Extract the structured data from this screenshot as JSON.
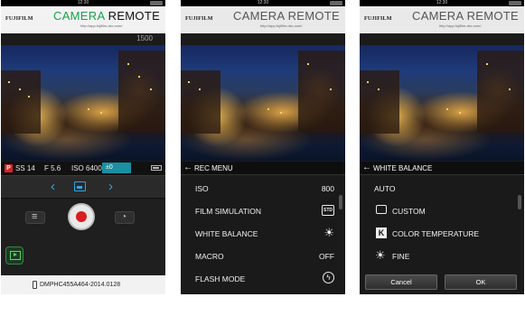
{
  "screens": [
    {
      "status_time": "12:30",
      "brand": "FUJIFILM",
      "title_part1": "CAMERA",
      "title_part2": "REMOTE",
      "url": "http://app.fujifilm-dsc.com/",
      "shots_remaining": "1500",
      "info": {
        "program_badge": "P",
        "shutter": "SS 14",
        "aperture": "F 5.6",
        "iso": "ISO 6400",
        "exposure": "±0"
      },
      "icons": [
        "left-chevron",
        "mode-icon",
        "right-chevron",
        "list-icon",
        "shutter-button",
        "self-timer-icon",
        "playback-icon",
        "phone-icon",
        "battery-icon"
      ],
      "device_name": "DMPHC455A464-2014.0128"
    },
    {
      "status_time": "12:30",
      "brand": "FUJIFILM",
      "title": "CAMERA REMOTE",
      "url": "http://app.fujifilm-dsc.com/",
      "menu_title": "REC MENU",
      "items": [
        {
          "label": "ISO",
          "value": "800"
        },
        {
          "label": "FILM SIMULATION",
          "value": "STD"
        },
        {
          "label": "WHITE BALANCE",
          "value": ""
        },
        {
          "label": "MACRO",
          "value": "OFF"
        },
        {
          "label": "FLASH MODE",
          "value": ""
        }
      ]
    },
    {
      "status_time": "12:30",
      "brand": "FUJIFILM",
      "title": "CAMERA REMOTE",
      "url": "http://app.fujifilm-dsc.com/",
      "menu_title": "WHITE BALANCE",
      "items": [
        {
          "label": "AUTO",
          "icon": "none"
        },
        {
          "label": "CUSTOM",
          "icon": "custom-icon"
        },
        {
          "label": "COLOR TEMPERATURE",
          "icon": "k-icon"
        },
        {
          "label": "FINE",
          "icon": "sun-icon"
        }
      ],
      "cancel_label": "Cancel",
      "ok_label": "OK"
    }
  ],
  "colors": {
    "accent_blue": "#2ea6e0",
    "title_green": "#16a34a",
    "record_red": "#d81e1e",
    "ev_teal": "#1b8fa3"
  }
}
